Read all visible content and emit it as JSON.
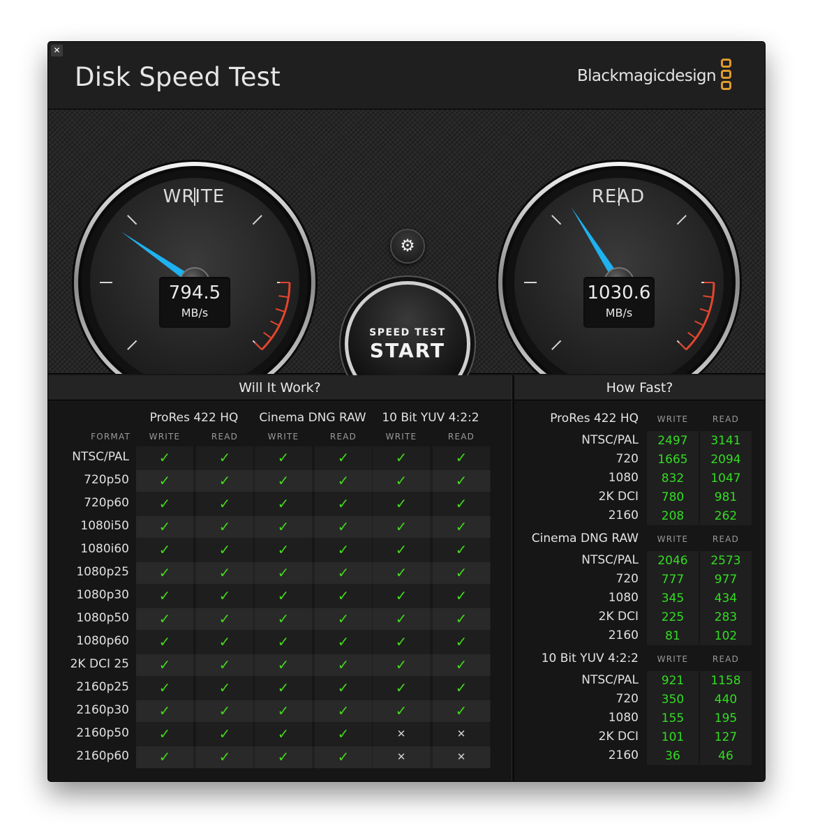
{
  "window": {
    "title": "Disk Speed Test",
    "brand": "Blackmagicdesign",
    "close_icon": "close-icon"
  },
  "gauges": {
    "write": {
      "label": "WRITE",
      "value": "794.5",
      "unit": "MB/s",
      "needle_fraction": 0.295
    },
    "read": {
      "label": "READ",
      "value": "1030.6",
      "unit": "MB/s",
      "needle_fraction": 0.38
    }
  },
  "controls": {
    "settings_icon": "gear-icon",
    "start_small": "SPEED TEST",
    "start_big": "START"
  },
  "will_it_work": {
    "title": "Will It Work?",
    "format_header": "FORMAT",
    "columns": [
      "ProRes 422 HQ",
      "Cinema DNG RAW",
      "10 Bit YUV 4:2:2"
    ],
    "sub_columns": [
      "WRITE",
      "READ"
    ],
    "rows": [
      {
        "format": "NTSC/PAL",
        "results": [
          true,
          true,
          true,
          true,
          true,
          true
        ]
      },
      {
        "format": "720p50",
        "results": [
          true,
          true,
          true,
          true,
          true,
          true
        ]
      },
      {
        "format": "720p60",
        "results": [
          true,
          true,
          true,
          true,
          true,
          true
        ]
      },
      {
        "format": "1080i50",
        "results": [
          true,
          true,
          true,
          true,
          true,
          true
        ]
      },
      {
        "format": "1080i60",
        "results": [
          true,
          true,
          true,
          true,
          true,
          true
        ]
      },
      {
        "format": "1080p25",
        "results": [
          true,
          true,
          true,
          true,
          true,
          true
        ]
      },
      {
        "format": "1080p30",
        "results": [
          true,
          true,
          true,
          true,
          true,
          true
        ]
      },
      {
        "format": "1080p50",
        "results": [
          true,
          true,
          true,
          true,
          true,
          true
        ]
      },
      {
        "format": "1080p60",
        "results": [
          true,
          true,
          true,
          true,
          true,
          true
        ]
      },
      {
        "format": "2K DCI 25",
        "results": [
          true,
          true,
          true,
          true,
          true,
          true
        ]
      },
      {
        "format": "2160p25",
        "results": [
          true,
          true,
          true,
          true,
          true,
          true
        ]
      },
      {
        "format": "2160p30",
        "results": [
          true,
          true,
          true,
          true,
          true,
          true
        ]
      },
      {
        "format": "2160p50",
        "results": [
          true,
          true,
          true,
          true,
          false,
          false
        ]
      },
      {
        "format": "2160p60",
        "results": [
          true,
          true,
          true,
          true,
          false,
          false
        ]
      }
    ],
    "check_glyph": "✓",
    "cross_glyph": "✕"
  },
  "how_fast": {
    "title": "How Fast?",
    "write_label": "WRITE",
    "read_label": "READ",
    "groups": [
      {
        "name": "ProRes 422 HQ",
        "rows": [
          {
            "format": "NTSC/PAL",
            "write": "2497",
            "read": "3141"
          },
          {
            "format": "720",
            "write": "1665",
            "read": "2094"
          },
          {
            "format": "1080",
            "write": "832",
            "read": "1047"
          },
          {
            "format": "2K DCI",
            "write": "780",
            "read": "981"
          },
          {
            "format": "2160",
            "write": "208",
            "read": "262"
          }
        ]
      },
      {
        "name": "Cinema DNG RAW",
        "rows": [
          {
            "format": "NTSC/PAL",
            "write": "2046",
            "read": "2573"
          },
          {
            "format": "720",
            "write": "777",
            "read": "977"
          },
          {
            "format": "1080",
            "write": "345",
            "read": "434"
          },
          {
            "format": "2K DCI",
            "write": "225",
            "read": "283"
          },
          {
            "format": "2160",
            "write": "81",
            "read": "102"
          }
        ]
      },
      {
        "name": "10 Bit YUV 4:2:2",
        "rows": [
          {
            "format": "NTSC/PAL",
            "write": "921",
            "read": "1158"
          },
          {
            "format": "720",
            "write": "350",
            "read": "440"
          },
          {
            "format": "1080",
            "write": "155",
            "read": "195"
          },
          {
            "format": "2K DCI",
            "write": "101",
            "read": "127"
          },
          {
            "format": "2160",
            "write": "36",
            "read": "46"
          }
        ]
      }
    ]
  },
  "colors": {
    "needle": "#1fb2f0",
    "redline": "#e2452f",
    "ok": "#44d81c",
    "value_green": "#33dd22",
    "brand_orange": "#e09a2d"
  }
}
